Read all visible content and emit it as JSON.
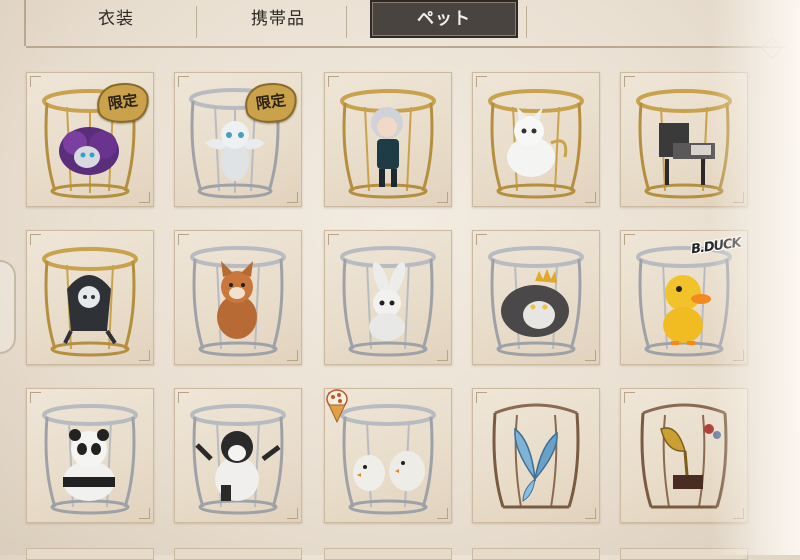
{
  "tabs": [
    {
      "label": "衣装",
      "active": false
    },
    {
      "label": "携帯品",
      "active": false
    },
    {
      "label": "ペット",
      "active": true
    }
  ],
  "colors": {
    "background": "#ece3d6",
    "card": "#e8dcc9",
    "cage_gold": "#c9a24e",
    "cage_silver": "#b8bcc2",
    "cage_bronze": "#8a6a50",
    "tab_active_bg": "#4a4440",
    "limited_badge": "#caa24c"
  },
  "pets": [
    {
      "name": "purple-fluffy-sheep-pet",
      "cage": "gold",
      "badge": "限定",
      "icon": "sheep-icon"
    },
    {
      "name": "white-winged-cat-pet",
      "cage": "silver",
      "badge": "限定",
      "icon": "cat-icon"
    },
    {
      "name": "chibi-doll-pet",
      "cage": "gold",
      "badge": "",
      "icon": "doll-icon"
    },
    {
      "name": "white-fox-pet",
      "cage": "gold",
      "badge": "",
      "icon": "fox-icon"
    },
    {
      "name": "mechanical-chair-pet",
      "cage": "gold",
      "badge": "",
      "icon": "chair-icon"
    },
    {
      "name": "dark-hooded-creature-pet",
      "cage": "gold",
      "badge": "",
      "icon": "hood-icon"
    },
    {
      "name": "brown-fox-pet",
      "cage": "silver",
      "badge": "",
      "icon": "fox-icon"
    },
    {
      "name": "rabbit-pet",
      "cage": "silver",
      "badge": "",
      "icon": "rabbit-icon"
    },
    {
      "name": "crowned-cat-pet",
      "cage": "silver",
      "badge": "",
      "icon": "crowned-cat-icon"
    },
    {
      "name": "yellow-duck-pet",
      "cage": "silver",
      "badge": "",
      "icon": "duck-icon",
      "sticker": "B.DUCK"
    },
    {
      "name": "panda-pet",
      "cage": "silver",
      "badge": "",
      "icon": "panda-icon"
    },
    {
      "name": "black-white-cat-pet",
      "cage": "silver",
      "badge": "",
      "icon": "cat-icon"
    },
    {
      "name": "two-chicks-pet",
      "cage": "silver",
      "badge": "",
      "icon": "chick-icon",
      "sticker_icon": "ice-cream-cone-icon"
    },
    {
      "name": "blue-butterfly-pet",
      "cage": "bronze",
      "badge": "",
      "icon": "butterfly-icon"
    },
    {
      "name": "gramophone-pet",
      "cage": "bronze",
      "badge": "",
      "icon": "gramophone-icon"
    }
  ]
}
